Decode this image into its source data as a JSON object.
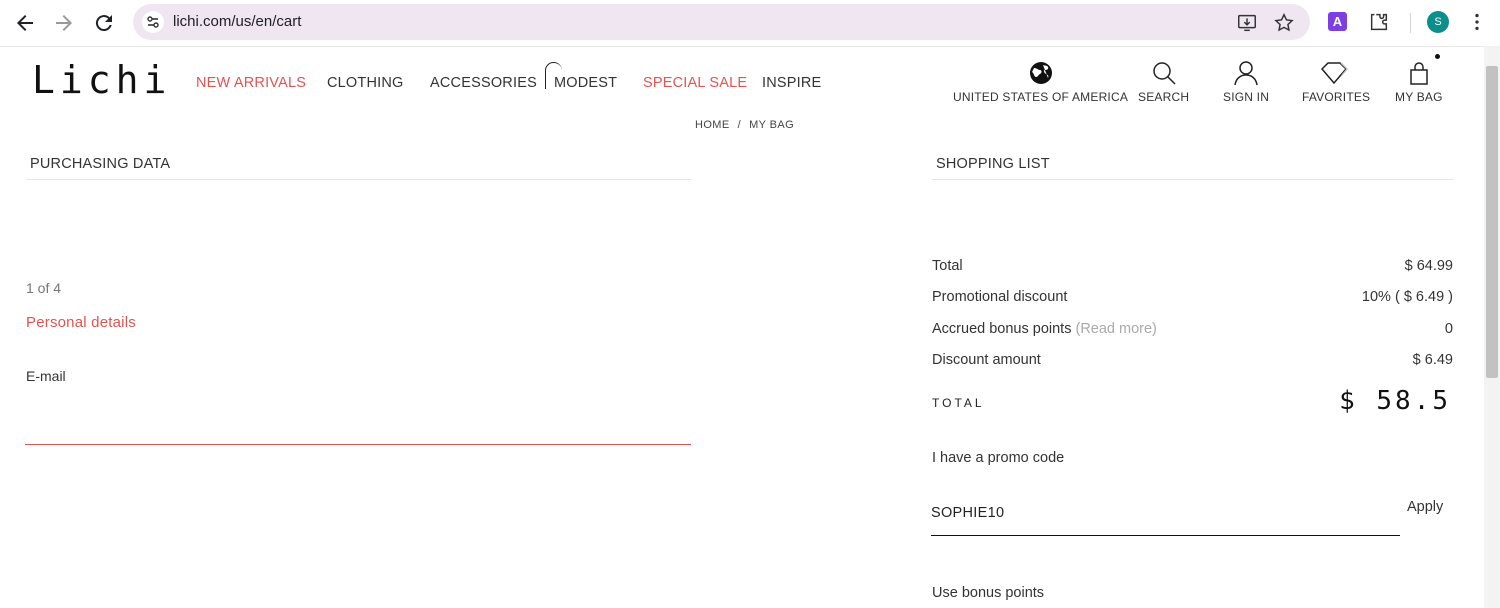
{
  "browser": {
    "url": "lichi.com/us/en/cart",
    "profile_initial": "S",
    "extension_letter": "A"
  },
  "site": {
    "logo": "Lichi",
    "menu": [
      {
        "label": "NEW ARRIVALS",
        "highlight": true
      },
      {
        "label": "CLOTHING",
        "highlight": false
      },
      {
        "label": "ACCESSORIES",
        "highlight": false
      },
      {
        "label": "MODEST",
        "highlight": false
      },
      {
        "label": "SPECIAL SALE",
        "highlight": true
      },
      {
        "label": "INSPIRE",
        "highlight": false
      }
    ],
    "header_actions": {
      "region": "UNITED STATES OF AMERICA",
      "search": "SEARCH",
      "sign_in": "SIGN IN",
      "favorites": "FAVORITES",
      "bag": "MY BAG"
    },
    "accent_color": "#e8524f"
  },
  "breadcrumb": {
    "home": "HOME",
    "separator": "/",
    "current": "MY BAG"
  },
  "purchasing": {
    "title": "PURCHASING DATA",
    "step": "1 of 4",
    "step_title": "Personal details",
    "email_label": "E-mail",
    "email_value": ""
  },
  "shopping_list": {
    "title": "SHOPPING LIST",
    "rows": [
      {
        "label": "Total",
        "value": "$ 64.99"
      },
      {
        "label": "Promotional discount",
        "value": "10% ( $ 6.49 )"
      },
      {
        "label": "Accrued bonus points",
        "link": "(Read more)",
        "value": "0"
      },
      {
        "label": "Discount amount",
        "value": "$ 6.49"
      }
    ],
    "grand_total_label": "TOTAL",
    "grand_total_value": "$ 58.5",
    "promo_question": "I have a promo code",
    "promo_code": "SOPHIE10",
    "apply_label": "Apply",
    "bonus_label": "Use bonus points"
  }
}
